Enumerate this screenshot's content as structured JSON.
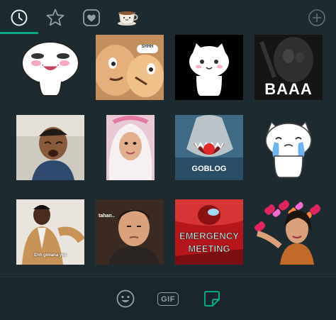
{
  "tabs": [
    {
      "name": "recent",
      "icon": "clock-icon",
      "active": true
    },
    {
      "name": "favorites",
      "icon": "star-icon",
      "active": false
    },
    {
      "name": "liked",
      "icon": "heart-icon",
      "active": false
    },
    {
      "name": "pack",
      "icon": "coffee-cup-icon",
      "active": false
    }
  ],
  "add_icon": "plus-icon",
  "stickers": [
    {
      "name": "white-blob-grin"
    },
    {
      "name": "cartoon-whisper",
      "text": "SHHH"
    },
    {
      "name": "white-cat"
    },
    {
      "name": "baaa-sticker",
      "text": "BAAA"
    },
    {
      "name": "crying-boy"
    },
    {
      "name": "hijab-girl"
    },
    {
      "name": "shark",
      "text": "GOBLOG"
    },
    {
      "name": "crying-cat"
    },
    {
      "name": "dancing-man",
      "text": "Ehh gimana yee"
    },
    {
      "name": "tahan-guy",
      "text": "tahan.."
    },
    {
      "name": "emergency-meeting",
      "line1": "EMERGENCY",
      "line2": "MEETING"
    },
    {
      "name": "hearts-woman"
    }
  ],
  "bottom": {
    "emoji_icon": "smiley-icon",
    "gif_label": "GIF",
    "sticker_icon": "sticker-icon",
    "active": "sticker"
  },
  "colors": {
    "accent": "#00a884",
    "background": "#1d2a30",
    "icon": "#8fa0a7"
  }
}
